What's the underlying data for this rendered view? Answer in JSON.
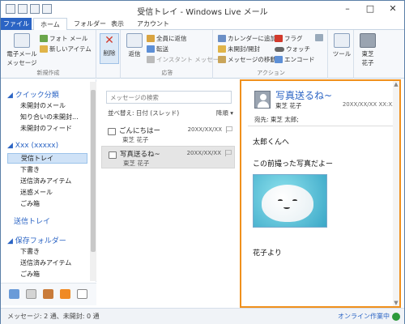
{
  "window": {
    "title": "受信トレイ - Windows Live メール"
  },
  "tabs": [
    "ファイル",
    "ホーム",
    "フォルダー",
    "表示",
    "アカウント"
  ],
  "ribbon": {
    "new_group": {
      "label": "新規作成",
      "email_message": "電子メール\nメッセージ",
      "photo_mail": "フォト メール",
      "new_item": "新しいアイテム"
    },
    "delete_label": "削除",
    "reply_group": {
      "label": "応答",
      "reply": "返信",
      "reply_all": "全員に返信",
      "forward": "転送",
      "im": "インスタント メッセージ"
    },
    "action_group": {
      "label": "アクション",
      "add_calendar": "カレンダーに追加",
      "unread_read": "未開封/開封",
      "move_message": "メッセージの移動",
      "flag": "フラグ",
      "watch": "ウォッチ",
      "encode": "エンコード"
    },
    "tools": "ツール",
    "user_name": "東芝\n花子"
  },
  "nav": {
    "quick_views": "クイック分類",
    "quick_items": [
      "未開封のメール",
      "知り合いの未開封...",
      "未開封のフィード"
    ],
    "account": "Xxx (xxxxx)",
    "account_items": [
      "受信トレイ",
      "下書き",
      "送信済みアイテム",
      "迷惑メール",
      "ごみ箱"
    ],
    "outbox": "送信トレイ",
    "storage": "保存フォルダー",
    "storage_items": [
      "下書き",
      "送信済みアイテム",
      "ごみ箱"
    ]
  },
  "message_list": {
    "search_placeholder": "メッセージの検索",
    "sort_label": "並べ替え: 日付 (スレッド)",
    "sort_order": "降順",
    "messages": [
      {
        "subject": "ごんにちはー",
        "from": "東芝 花子",
        "date": "20XX/XX/XX"
      },
      {
        "subject": "写真送るね~",
        "from": "東芝 花子",
        "date": "20XX/XX/XX"
      }
    ]
  },
  "reading": {
    "subject": "写真送るね~",
    "from": "東芝 花子",
    "date": "20XX/XX/XX XX:XX",
    "to": "宛先: 東芝 太郎;",
    "body_lines": [
      "太郎くんへ",
      "この前撮った写真だよー",
      "花子より"
    ]
  },
  "status": {
    "left": "メッセージ: 2 通、未開封: 0 通",
    "right": "オンライン作業中"
  },
  "colors": {
    "accent": "#2b64c4",
    "highlight": "#f0901c"
  }
}
